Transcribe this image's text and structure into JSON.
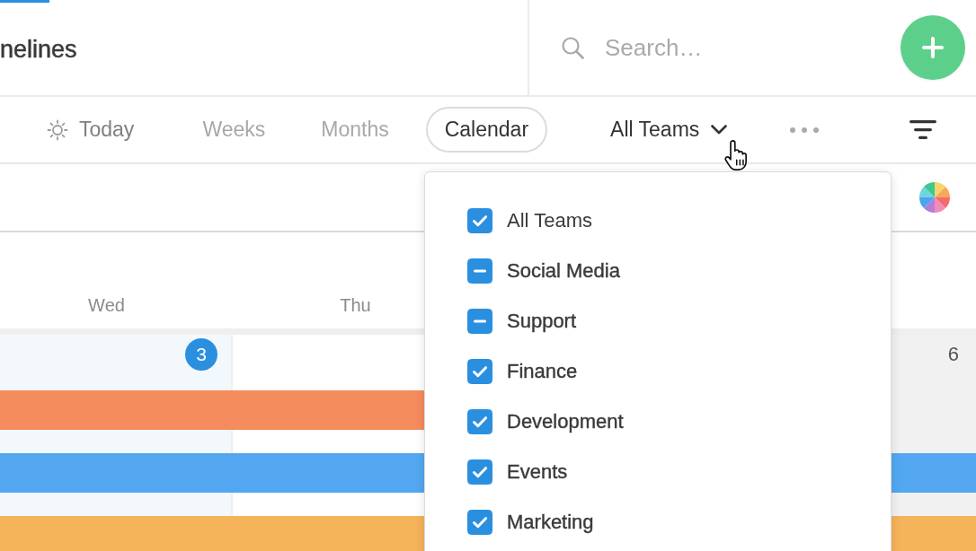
{
  "header": {
    "title": "nelines",
    "search": {
      "placeholder": "Search…"
    }
  },
  "toolbar": {
    "today_button": {
      "label": "Today"
    },
    "views": [
      {
        "label": "Weeks",
        "selected": false
      },
      {
        "label": "Months",
        "selected": false
      },
      {
        "label": "Calendar",
        "selected": true
      }
    ],
    "team_filter": {
      "label": "All Teams",
      "expanded": true
    }
  },
  "calendar": {
    "days": [
      {
        "name": "Wed",
        "date": "3",
        "today": true,
        "weekend": false
      },
      {
        "name": "Thu",
        "today": false,
        "weekend": false
      },
      {
        "date": "6",
        "today": false,
        "weekend": true
      }
    ],
    "events": [
      {
        "color": "#f58c5e",
        "continues": false
      },
      {
        "color": "#52a7f0",
        "continues": true
      },
      {
        "color": "#f5b35a",
        "continues": true
      }
    ]
  },
  "team_menu": {
    "items": [
      {
        "kind": "all",
        "label": "All Teams",
        "checked": true,
        "mixed": false
      },
      {
        "kind": "team",
        "label": "Social Media",
        "checked": true,
        "mixed": true
      },
      {
        "kind": "team",
        "label": "Support",
        "checked": true,
        "mixed": true
      },
      {
        "kind": "team",
        "label": "Finance",
        "checked": true,
        "mixed": false
      },
      {
        "kind": "team",
        "label": "Development",
        "checked": true,
        "mixed": false
      },
      {
        "kind": "team",
        "label": "Events",
        "checked": true,
        "mixed": false
      },
      {
        "kind": "team",
        "label": "Marketing",
        "checked": true,
        "mixed": false
      }
    ]
  }
}
